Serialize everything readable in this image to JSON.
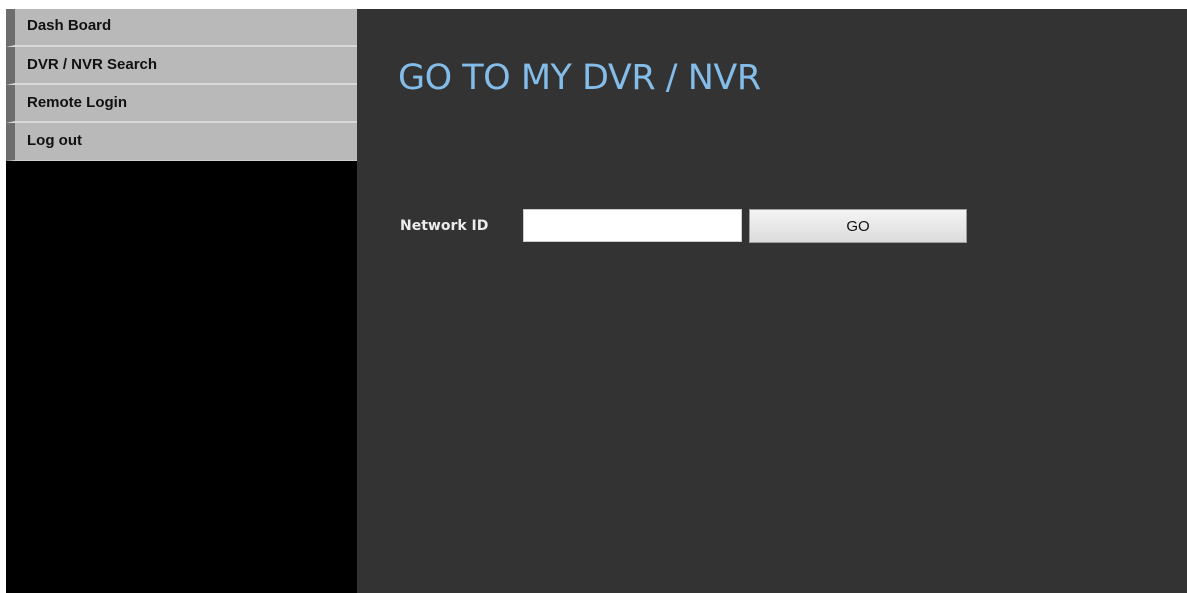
{
  "sidebar": {
    "items": [
      {
        "label": "Dash Board"
      },
      {
        "label": "DVR / NVR Search"
      },
      {
        "label": "Remote Login"
      },
      {
        "label": "Log out"
      }
    ]
  },
  "main": {
    "title": "GO TO MY DVR / NVR",
    "form": {
      "network_id_label": "Network ID",
      "network_id_value": "",
      "go_label": "GO"
    }
  },
  "colors": {
    "title": "#84bde9",
    "main_background": "#333333",
    "sidebar_background": "#000000",
    "nav_item_background": "#b9b9b9"
  }
}
